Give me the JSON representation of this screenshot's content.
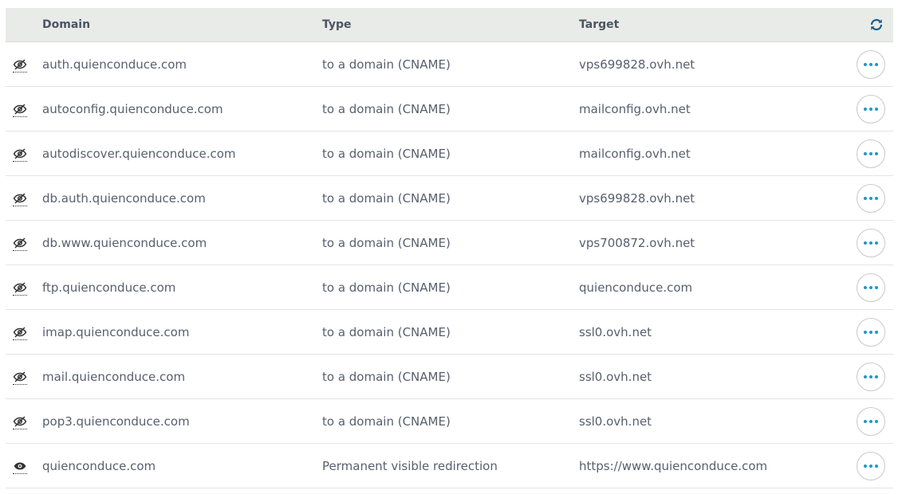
{
  "header": {
    "domain": "Domain",
    "type": "Type",
    "target": "Target"
  },
  "rows": [
    {
      "domain": "auth.quienconduce.com",
      "type": "to a domain (CNAME)",
      "target": "vps699828.ovh.net",
      "visibility": "hidden"
    },
    {
      "domain": "autoconfig.quienconduce.com",
      "type": "to a domain (CNAME)",
      "target": "mailconfig.ovh.net",
      "visibility": "hidden"
    },
    {
      "domain": "autodiscover.quienconduce.com",
      "type": "to a domain (CNAME)",
      "target": "mailconfig.ovh.net",
      "visibility": "hidden"
    },
    {
      "domain": "db.auth.quienconduce.com",
      "type": "to a domain (CNAME)",
      "target": "vps699828.ovh.net",
      "visibility": "hidden"
    },
    {
      "domain": "db.www.quienconduce.com",
      "type": "to a domain (CNAME)",
      "target": "vps700872.ovh.net",
      "visibility": "hidden"
    },
    {
      "domain": "ftp.quienconduce.com",
      "type": "to a domain (CNAME)",
      "target": "quienconduce.com",
      "visibility": "hidden"
    },
    {
      "domain": "imap.quienconduce.com",
      "type": "to a domain (CNAME)",
      "target": "ssl0.ovh.net",
      "visibility": "hidden"
    },
    {
      "domain": "mail.quienconduce.com",
      "type": "to a domain (CNAME)",
      "target": "ssl0.ovh.net",
      "visibility": "hidden"
    },
    {
      "domain": "pop3.quienconduce.com",
      "type": "to a domain (CNAME)",
      "target": "ssl0.ovh.net",
      "visibility": "hidden"
    },
    {
      "domain": "quienconduce.com",
      "type": "Permanent visible redirection",
      "target": "https://www.quienconduce.com",
      "visibility": "visible"
    }
  ],
  "icons": {
    "refresh": "refresh-icon",
    "hidden": "eye-slash-icon",
    "visible": "eye-icon",
    "actions": "ellipsis-icon"
  },
  "colors": {
    "header_bg": "#e9ebe8",
    "accent": "#1c98c9",
    "text": "#57606e"
  }
}
